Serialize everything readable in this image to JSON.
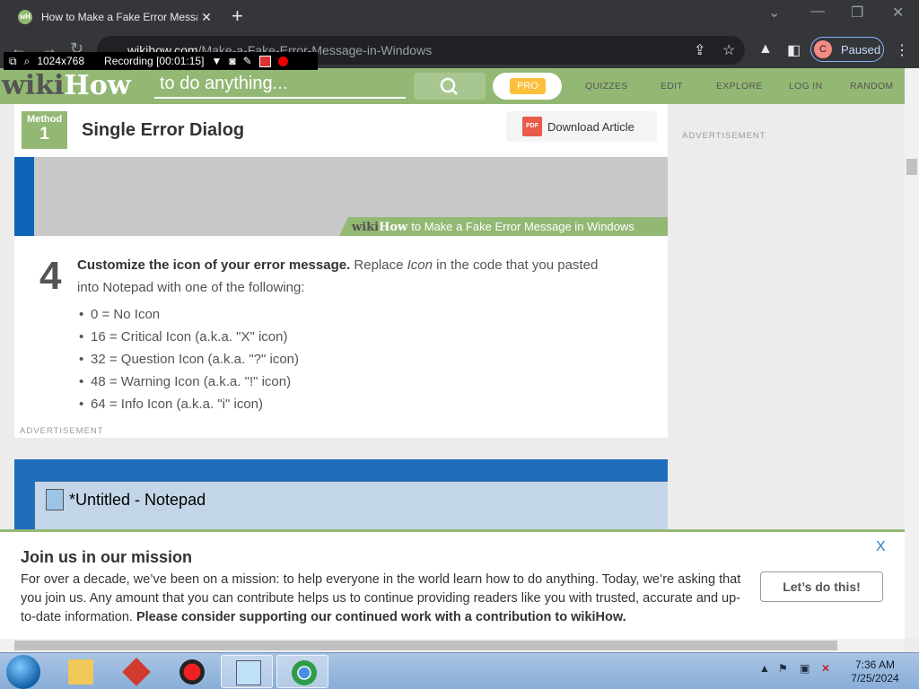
{
  "browser": {
    "tab_title": "How to Make a Fake Error Messa",
    "tab_favicon": "wH",
    "url_host": "wikihow.com",
    "url_path": "/Make-a-Fake-Error-Message-in-Windows",
    "profile_initial": "C",
    "profile_status": "Paused"
  },
  "recorder": {
    "resolution": "1024x768",
    "status": "Recording [00:01:15]"
  },
  "site_header": {
    "logo_wiki": "wiki",
    "logo_how": "How",
    "search_placeholder": "to do anything...",
    "pro_label": "PRO",
    "nav": [
      "QUIZZES",
      "EDIT",
      "EXPLORE",
      "LOG IN",
      "RANDOM"
    ]
  },
  "method": {
    "label": "Method",
    "number": "1",
    "title": "Single Error Dialog",
    "download_label": "Download Article",
    "pdf_badge": "PDF"
  },
  "sidebar": {
    "advertisement": "ADVERTISEMENT"
  },
  "step_image_caption": {
    "wiki": "wiki",
    "how": "How",
    "text": "to Make a Fake Error Message in Windows"
  },
  "step": {
    "number": "4",
    "bold_lead": "Customize the icon of your error message.",
    "text_before": " Replace ",
    "italic_word": "Icon",
    "text_after": " in the code that you pasted into Notepad with one of the following:",
    "items": [
      "0 = No Icon",
      "16 = Critical Icon (a.k.a. \"X\" icon)",
      "32 = Question Icon (a.k.a. \"?\" icon)",
      "48 = Warning Icon (a.k.a. \"!\" icon)",
      "64 = Info Icon (a.k.a. \"i\" icon)"
    ],
    "advertisement": "ADVERTISEMENT"
  },
  "notepad_image": {
    "title": "*Untitled - Notepad"
  },
  "mission_banner": {
    "heading": "Join us in our mission",
    "body": "For over a decade, we’ve been on a mission: to help everyone in the world learn how to do anything. Today, we’re asking that you join us. Any amount that you can contribute helps us to continue providing readers like you with trusted, accurate and up-to-date information. ",
    "body_bold": "Please consider supporting our continued work with a contribution to wikiHow.",
    "cta": "Let’s do this!",
    "close": "X"
  },
  "taskbar": {
    "time": "7:36 AM",
    "date": "7/25/2024"
  },
  "colors": {
    "wikihow_green": "#93b874",
    "chrome_dark": "#35363a",
    "pro_yellow": "#fbbf3a"
  }
}
